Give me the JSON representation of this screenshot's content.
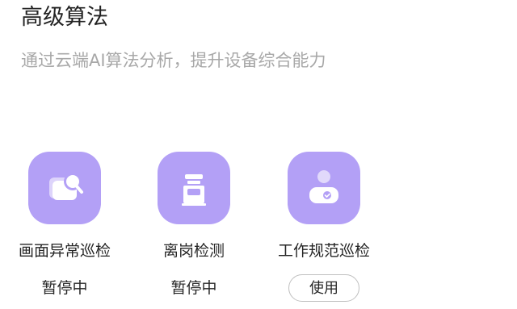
{
  "header": {
    "title": "高级算法",
    "subtitle": "通过云端AI算法分析，提升设备综合能力"
  },
  "features": [
    {
      "name": "画面异常巡检",
      "status": "暂停中",
      "icon": "image-search-icon"
    },
    {
      "name": "离岗检测",
      "status": "暂停中",
      "icon": "post-absence-icon"
    },
    {
      "name": "工作规范巡检",
      "action_label": "使用",
      "icon": "person-check-icon"
    }
  ],
  "colors": {
    "icon_tile": "#b3a0f6",
    "icon_glyph": "#ffffff",
    "title_text": "#222222",
    "subtitle_text": "#a8a8a8",
    "button_border": "#bfbfbf"
  }
}
